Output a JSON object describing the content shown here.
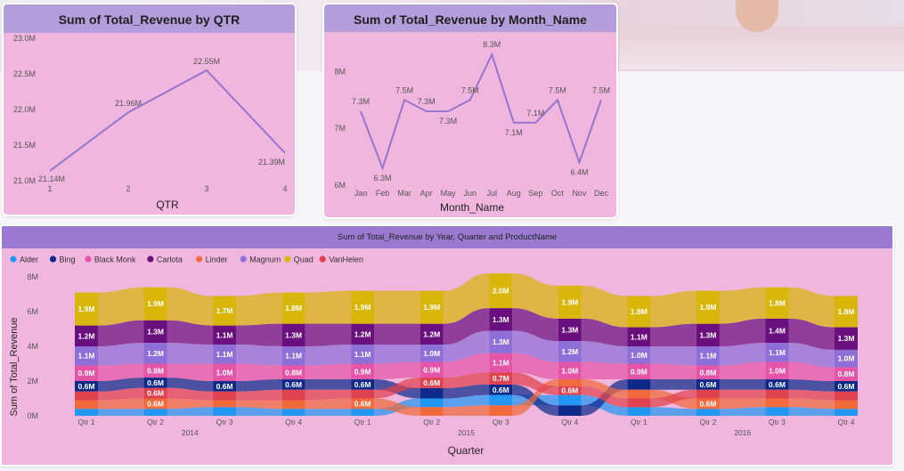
{
  "colors": {
    "card_bg": "#f0b6dd",
    "header_bg": "#b39ddb",
    "header_bg_dark": "#9a7ad1",
    "line": "#9575cd"
  },
  "chart_data": [
    {
      "type": "line",
      "title": "Sum of Total_Revenue by QTR",
      "xlabel": "QTR",
      "ylabel": "",
      "x": [
        "1",
        "2",
        "3",
        "4"
      ],
      "values": [
        21.14,
        21.96,
        22.55,
        21.39
      ],
      "data_labels": [
        "21.14M",
        "21.96M",
        "22.55M",
        "21.39M"
      ],
      "yticks": [
        "21.0M",
        "21.5M",
        "22.0M",
        "22.5M",
        "23.0M"
      ],
      "ylim": [
        21.0,
        23.0
      ]
    },
    {
      "type": "line",
      "title": "Sum of Total_Revenue by Month_Name",
      "xlabel": "Month_Name",
      "ylabel": "",
      "x": [
        "Jan",
        "Feb",
        "Mar",
        "Apr",
        "May",
        "Jun",
        "Jul",
        "Aug",
        "Sep",
        "Oct",
        "Nov",
        "Dec"
      ],
      "values": [
        7.3,
        6.3,
        7.5,
        7.3,
        7.3,
        7.5,
        8.3,
        7.1,
        7.1,
        7.5,
        6.4,
        7.5
      ],
      "data_labels": [
        "7.3M",
        "6.3M",
        "7.5M",
        "7.3M",
        "7.3M",
        "7.5M",
        "8.3M",
        "7.1M",
        "7.1M",
        "7.5M",
        "6.4M",
        "7.5M"
      ],
      "yticks": [
        "6M",
        "7M",
        "8M"
      ],
      "ylim": [
        6,
        8.5
      ]
    },
    {
      "type": "area",
      "subtype": "ribbon",
      "title": "Sum of Total_Revenue by Year, Quarter and ProductName",
      "xlabel": "Quarter",
      "ylabel": "Sum of Total_Revenue",
      "yticks": [
        "0M",
        "2M",
        "4M",
        "6M",
        "8M"
      ],
      "ylim": [
        0,
        8
      ],
      "legend_position": "top-left",
      "categories": [
        "Qtr 1",
        "Qtr 2",
        "Qtr 3",
        "Qtr 4",
        "Qtr 1",
        "Qtr 2",
        "Qtr 3",
        "Qtr 4",
        "Qtr 1",
        "Qtr 2",
        "Qtr 3",
        "Qtr 4"
      ],
      "years": [
        {
          "label": "2014",
          "start": 0,
          "end": 3
        },
        {
          "label": "2015",
          "start": 4,
          "end": 7
        },
        {
          "label": "2016",
          "start": 8,
          "end": 11
        }
      ],
      "series": [
        {
          "name": "Alder",
          "color": "#2196f3",
          "values": [
            0.4,
            0.4,
            0.5,
            0.4,
            0.4,
            0.5,
            0.6,
            0.6,
            0.5,
            0.4,
            0.5,
            0.4
          ]
        },
        {
          "name": "Bing",
          "color": "#0d2a8a",
          "values": [
            0.6,
            0.6,
            0.6,
            0.6,
            0.6,
            0.6,
            0.6,
            0.6,
            0.6,
            0.6,
            0.6,
            0.6
          ],
          "labels": [
            "0.6M",
            "0.6M",
            "0.6M",
            "0.6M",
            "0.6M",
            "",
            "0.6M",
            "",
            "",
            "0.6M",
            "0.6M",
            "0.6M"
          ]
        },
        {
          "name": "Black Monk",
          "color": "#e455a8",
          "values": [
            0.9,
            0.8,
            1.0,
            0.8,
            0.9,
            0.9,
            1.1,
            1.0,
            0.9,
            0.8,
            1.0,
            0.8
          ],
          "labels": [
            "0.9M",
            "0.8M",
            "1.0M",
            "0.8M",
            "0.9M",
            "0.9M",
            "1.1M",
            "1.0M",
            "0.9M",
            "0.8M",
            "1.0M",
            "0.8M"
          ]
        },
        {
          "name": "Carlota",
          "color": "#6a0f7e",
          "values": [
            1.2,
            1.3,
            1.1,
            1.3,
            1.2,
            1.2,
            1.3,
            1.3,
            1.1,
            1.3,
            1.4,
            1.3
          ],
          "labels": [
            "1.2M",
            "1.3M",
            "1.1M",
            "1.3M",
            "1.2M",
            "1.2M",
            "1.3M",
            "1.3M",
            "1.1M",
            "1.3M",
            "1.4M",
            "1.3M"
          ]
        },
        {
          "name": "Linder",
          "color": "#f06a3c",
          "values": [
            0.5,
            0.6,
            0.4,
            0.5,
            0.6,
            0.5,
            0.6,
            0.4,
            0.5,
            0.6,
            0.5,
            0.5
          ],
          "labels": [
            "",
            "0.6M",
            "",
            "",
            "0.6M",
            "",
            "",
            "",
            "",
            "0.6M",
            "",
            ""
          ]
        },
        {
          "name": "Magnum",
          "color": "#8e6fd8",
          "values": [
            1.1,
            1.2,
            1.1,
            1.1,
            1.1,
            1.0,
            1.3,
            1.2,
            1.0,
            1.1,
            1.1,
            1.0
          ],
          "labels": [
            "1.1M",
            "1.2M",
            "1.1M",
            "1.1M",
            "1.1M",
            "1.0M",
            "1.3M",
            "1.2M",
            "1.0M",
            "1.1M",
            "1.1M",
            "1.0M"
          ]
        },
        {
          "name": "Quad",
          "color": "#d8b60a",
          "values": [
            1.9,
            1.9,
            1.7,
            1.8,
            1.9,
            1.9,
            2.0,
            1.9,
            1.8,
            1.9,
            1.8,
            1.8
          ],
          "labels": [
            "1.9M",
            "1.9M",
            "1.7M",
            "1.8M",
            "1.9M",
            "1.9M",
            "2.0M",
            "1.9M",
            "1.8M",
            "1.9M",
            "1.8M",
            "1.8M"
          ]
        },
        {
          "name": "VanHelen",
          "color": "#e0414f",
          "values": [
            0.5,
            0.6,
            0.5,
            0.6,
            0.5,
            0.6,
            0.7,
            0.5,
            0.5,
            0.5,
            0.5,
            0.5
          ],
          "labels": [
            "",
            "0.6M",
            "",
            "",
            "",
            "0.6M",
            "0.7M",
            "0.6M",
            "",
            "",
            "",
            ""
          ]
        }
      ],
      "stack_orders": [
        [
          "Alder",
          "Linder",
          "VanHelen",
          "Bing",
          "Black Monk",
          "Magnum",
          "Carlota",
          "Quad"
        ],
        [
          "Alder",
          "Linder",
          "VanHelen",
          "Bing",
          "Black Monk",
          "Magnum",
          "Carlota",
          "Quad"
        ],
        [
          "Alder",
          "Linder",
          "VanHelen",
          "Bing",
          "Black Monk",
          "Magnum",
          "Carlota",
          "Quad"
        ],
        [
          "Alder",
          "Linder",
          "VanHelen",
          "Bing",
          "Black Monk",
          "Magnum",
          "Carlota",
          "Quad"
        ],
        [
          "Alder",
          "Linder",
          "VanHelen",
          "Bing",
          "Black Monk",
          "Magnum",
          "Carlota",
          "Quad"
        ],
        [
          "Linder",
          "Alder",
          "Bing",
          "VanHelen",
          "Black Monk",
          "Magnum",
          "Carlota",
          "Quad"
        ],
        [
          "Linder",
          "Alder",
          "Bing",
          "VanHelen",
          "Black Monk",
          "Magnum",
          "Carlota",
          "Quad"
        ],
        [
          "Bing",
          "Alder",
          "VanHelen",
          "Linder",
          "Black Monk",
          "Magnum",
          "Carlota",
          "Quad"
        ],
        [
          "Alder",
          "VanHelen",
          "Linder",
          "Bing",
          "Black Monk",
          "Magnum",
          "Carlota",
          "Quad"
        ],
        [
          "Alder",
          "Linder",
          "VanHelen",
          "Bing",
          "Black Monk",
          "Magnum",
          "Carlota",
          "Quad"
        ],
        [
          "Alder",
          "Linder",
          "VanHelen",
          "Bing",
          "Black Monk",
          "Magnum",
          "Carlota",
          "Quad"
        ],
        [
          "Alder",
          "Linder",
          "VanHelen",
          "Bing",
          "Black Monk",
          "Magnum",
          "Carlota",
          "Quad"
        ]
      ]
    }
  ]
}
